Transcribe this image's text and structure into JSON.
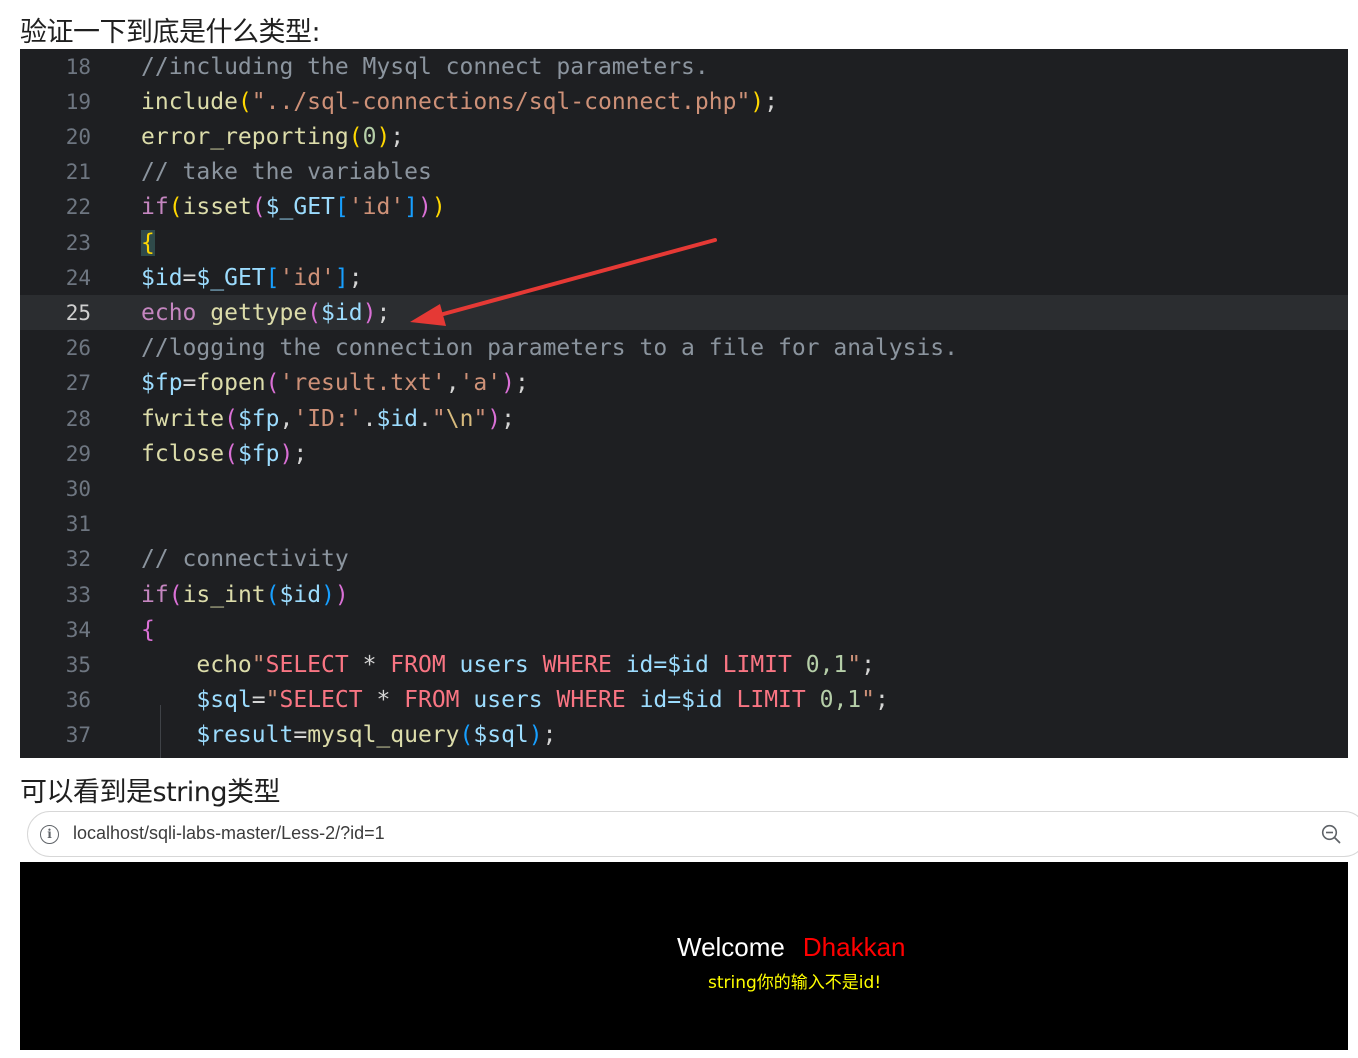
{
  "headings": {
    "top": "验证一下到底是什么类型:",
    "middle": "可以看到是string类型"
  },
  "code": {
    "current_line": "25",
    "lines": [
      {
        "no": "18",
        "tokens": [
          {
            "t": "//including the Mysql connect parameters.",
            "c": "cm"
          }
        ]
      },
      {
        "no": "19",
        "tokens": [
          {
            "t": "include",
            "c": "fn"
          },
          {
            "t": "(",
            "c": "b1"
          },
          {
            "t": "\"../sql-connections/sql-connect.php\"",
            "c": "s"
          },
          {
            "t": ")",
            "c": "b1"
          },
          {
            "t": ";",
            "c": "p"
          }
        ]
      },
      {
        "no": "20",
        "tokens": [
          {
            "t": "error_reporting",
            "c": "fn"
          },
          {
            "t": "(",
            "c": "b1"
          },
          {
            "t": "0",
            "c": "n"
          },
          {
            "t": ")",
            "c": "b1"
          },
          {
            "t": ";",
            "c": "p"
          }
        ]
      },
      {
        "no": "21",
        "tokens": [
          {
            "t": "// take the variables",
            "c": "cm"
          }
        ]
      },
      {
        "no": "22",
        "tokens": [
          {
            "t": "if",
            "c": "kw"
          },
          {
            "t": "(",
            "c": "b1"
          },
          {
            "t": "isset",
            "c": "fn"
          },
          {
            "t": "(",
            "c": "b2"
          },
          {
            "t": "$_GET",
            "c": "v"
          },
          {
            "t": "[",
            "c": "b3"
          },
          {
            "t": "'id'",
            "c": "s"
          },
          {
            "t": "]",
            "c": "b3"
          },
          {
            "t": ")",
            "c": "b2"
          },
          {
            "t": ")",
            "c": "b1"
          }
        ]
      },
      {
        "no": "23",
        "tokens": [
          {
            "t": "{",
            "c": "b1 cur"
          }
        ]
      },
      {
        "no": "24",
        "tokens": [
          {
            "t": "$id",
            "c": "v"
          },
          {
            "t": "=",
            "c": "p"
          },
          {
            "t": "$_GET",
            "c": "v"
          },
          {
            "t": "[",
            "c": "b3"
          },
          {
            "t": "'id'",
            "c": "s"
          },
          {
            "t": "]",
            "c": "b3"
          },
          {
            "t": ";",
            "c": "p"
          }
        ]
      },
      {
        "no": "25",
        "tokens": [
          {
            "t": "echo ",
            "c": "kw"
          },
          {
            "t": "gettype",
            "c": "fn"
          },
          {
            "t": "(",
            "c": "b2"
          },
          {
            "t": "$id",
            "c": "v"
          },
          {
            "t": ")",
            "c": "b2"
          },
          {
            "t": ";",
            "c": "p"
          }
        ]
      },
      {
        "no": "26",
        "tokens": [
          {
            "t": "//logging the connection parameters to a file for analysis.",
            "c": "cm"
          }
        ]
      },
      {
        "no": "27",
        "tokens": [
          {
            "t": "$fp",
            "c": "v"
          },
          {
            "t": "=",
            "c": "p"
          },
          {
            "t": "fopen",
            "c": "fn"
          },
          {
            "t": "(",
            "c": "b2"
          },
          {
            "t": "'result.txt'",
            "c": "s"
          },
          {
            "t": ",",
            "c": "p"
          },
          {
            "t": "'a'",
            "c": "s"
          },
          {
            "t": ")",
            "c": "b2"
          },
          {
            "t": ";",
            "c": "p"
          }
        ]
      },
      {
        "no": "28",
        "tokens": [
          {
            "t": "fwrite",
            "c": "fn"
          },
          {
            "t": "(",
            "c": "b2"
          },
          {
            "t": "$fp",
            "c": "v"
          },
          {
            "t": ",",
            "c": "p"
          },
          {
            "t": "'ID:'",
            "c": "s"
          },
          {
            "t": ".",
            "c": "p"
          },
          {
            "t": "$id",
            "c": "v"
          },
          {
            "t": ".",
            "c": "p"
          },
          {
            "t": "\"",
            "c": "s"
          },
          {
            "t": "\\n",
            "c": "e"
          },
          {
            "t": "\"",
            "c": "s"
          },
          {
            "t": ")",
            "c": "b2"
          },
          {
            "t": ";",
            "c": "p"
          }
        ]
      },
      {
        "no": "29",
        "tokens": [
          {
            "t": "fclose",
            "c": "fn"
          },
          {
            "t": "(",
            "c": "b2"
          },
          {
            "t": "$fp",
            "c": "v"
          },
          {
            "t": ")",
            "c": "b2"
          },
          {
            "t": ";",
            "c": "p"
          }
        ]
      },
      {
        "no": "30",
        "tokens": []
      },
      {
        "no": "31",
        "tokens": []
      },
      {
        "no": "32",
        "tokens": [
          {
            "t": "// connectivity",
            "c": "cm"
          }
        ]
      },
      {
        "no": "33",
        "tokens": [
          {
            "t": "if",
            "c": "kw"
          },
          {
            "t": "(",
            "c": "b2"
          },
          {
            "t": "is_int",
            "c": "fn"
          },
          {
            "t": "(",
            "c": "b3"
          },
          {
            "t": "$id",
            "c": "v"
          },
          {
            "t": ")",
            "c": "b3"
          },
          {
            "t": ")",
            "c": "b2"
          }
        ]
      },
      {
        "no": "34",
        "tokens": [
          {
            "t": "{",
            "c": "b2"
          }
        ]
      },
      {
        "no": "35",
        "tokens": [
          {
            "t": "    echo",
            "c": "fn"
          },
          {
            "t": "\"",
            "c": "s"
          },
          {
            "t": "SELECT",
            "c": "sq"
          },
          {
            "t": " * ",
            "c": "p"
          },
          {
            "t": "FROM",
            "c": "sq"
          },
          {
            "t": " users ",
            "c": "v"
          },
          {
            "t": "WHERE",
            "c": "sq"
          },
          {
            "t": " id=$id ",
            "c": "v"
          },
          {
            "t": "LIMIT",
            "c": "sq"
          },
          {
            "t": " 0,1",
            "c": "n"
          },
          {
            "t": "\"",
            "c": "s"
          },
          {
            "t": ";",
            "c": "p"
          }
        ]
      },
      {
        "no": "36",
        "tokens": [
          {
            "t": "    $sql",
            "c": "v"
          },
          {
            "t": "=",
            "c": "p"
          },
          {
            "t": "\"",
            "c": "s"
          },
          {
            "t": "SELECT",
            "c": "sq"
          },
          {
            "t": " * ",
            "c": "p"
          },
          {
            "t": "FROM",
            "c": "sq"
          },
          {
            "t": " users ",
            "c": "v"
          },
          {
            "t": "WHERE",
            "c": "sq"
          },
          {
            "t": " id=$id ",
            "c": "v"
          },
          {
            "t": "LIMIT",
            "c": "sq"
          },
          {
            "t": " 0,1",
            "c": "n"
          },
          {
            "t": "\"",
            "c": "s"
          },
          {
            "t": ";",
            "c": "p"
          }
        ]
      },
      {
        "no": "37",
        "tokens": [
          {
            "t": "    $result",
            "c": "v"
          },
          {
            "t": "=",
            "c": "p"
          },
          {
            "t": "mysql_query",
            "c": "fn"
          },
          {
            "t": "(",
            "c": "b3"
          },
          {
            "t": "$sql",
            "c": "v"
          },
          {
            "t": ")",
            "c": "b3"
          },
          {
            "t": ";",
            "c": "p"
          }
        ]
      }
    ]
  },
  "browser": {
    "url": "localhost/sqli-labs-master/Less-2/?id=1",
    "info_icon": "info-icon",
    "zoom_icon": "zoom-out-icon"
  },
  "page": {
    "welcome_word": "Welcome",
    "welcome_name": "Dhakkan",
    "result_message": "string你的输入不是id!"
  },
  "colors": {
    "annotation_arrow": "#e53935",
    "welcome_name": "#ff0000",
    "result_message": "#ffff00"
  }
}
